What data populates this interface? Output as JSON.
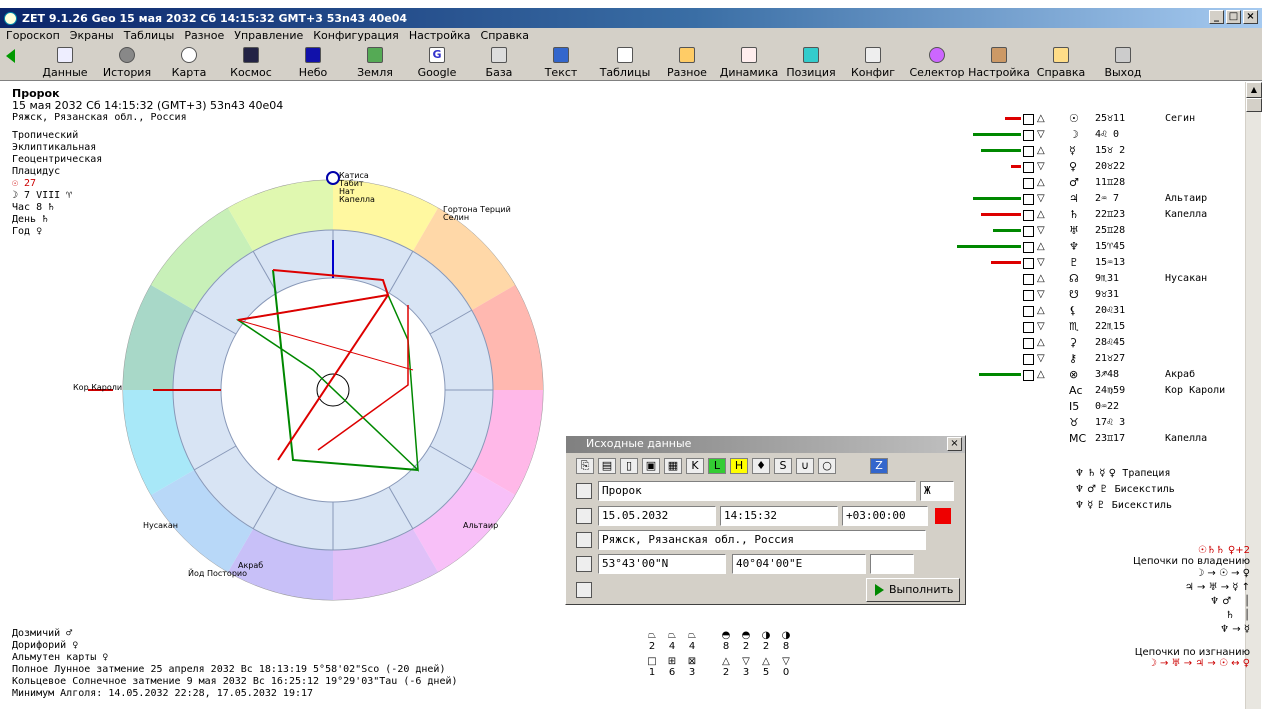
{
  "window": {
    "title": "ZET 9.1.26 Geo   15 мая 2032  Сб  14:15:32 GMT+3 53n43  40e04"
  },
  "menu": [
    "Гороскоп",
    "Экраны",
    "Таблицы",
    "Разное",
    "Управление",
    "Конфигурация",
    "Настройка",
    "Справка"
  ],
  "toolbar": [
    "Данные",
    "История",
    "Карта",
    "Космос",
    "Небо",
    "Земля",
    "Google",
    "База",
    "Текст",
    "Таблицы",
    "Разное",
    "Динамика",
    "Позиция",
    "Конфиг",
    "Селектор",
    "Настройка",
    "Справка",
    "Выход"
  ],
  "info": {
    "name": "Пророк",
    "date": "15 мая 2032  Сб  14:15:32 (GMT+3) 53n43  40e04",
    "place": "Ряжск, Рязанская обл., Россия",
    "zodiac": "Тропический",
    "coord": "Эклиптикальная",
    "center": "Геоцентрическая",
    "houses": "Плацидус",
    "sun_line": "☉  27",
    "moon_line": "☽  7 VIII ♈",
    "hour": "Час 8  ♄",
    "day": "День  ♄",
    "year": "Год  ♀"
  },
  "chart_labels": {
    "top": "Катиса",
    "top2": "Табит",
    "top3": "Нат",
    "top4": "Капелла",
    "right_top": "Гортона Терций",
    "right_top2": "Селин",
    "left": "Кор Кароли",
    "lower_left": "Нусакан",
    "lower_right": "Альтаир",
    "bottom": "Акраб",
    "bottom2": "Йод Посторио"
  },
  "planets": [
    {
      "glyph": "☉",
      "pos": "25♉11",
      "star": "Сегин"
    },
    {
      "glyph": "☽",
      "pos": " 4♌ 0",
      "star": ""
    },
    {
      "glyph": "☿",
      "pos": "15♉ 2",
      "star": ""
    },
    {
      "glyph": "♀",
      "pos": "20♉22",
      "star": ""
    },
    {
      "glyph": "♂",
      "pos": "11♊28",
      "star": ""
    },
    {
      "glyph": "♃",
      "pos": " 2♒ 7",
      "star": "Альтаир"
    },
    {
      "glyph": "♄",
      "pos": "22♊23",
      "star": "Капелла"
    },
    {
      "glyph": "♅",
      "pos": "25♊28",
      "star": ""
    },
    {
      "glyph": "♆",
      "pos": "15♈45",
      "star": ""
    },
    {
      "glyph": "♇",
      "pos": "15♒13",
      "star": ""
    },
    {
      "glyph": "☊",
      "pos": " 9♏31",
      "star": "Нусакан"
    },
    {
      "glyph": "☋",
      "pos": " 9♉31",
      "star": ""
    },
    {
      "glyph": "⚸",
      "pos": "20♌31",
      "star": ""
    },
    {
      "glyph": "♏",
      "pos": "22♏15",
      "star": ""
    },
    {
      "glyph": "⚳",
      "pos": "28♌45",
      "star": ""
    },
    {
      "glyph": "⚷",
      "pos": "21♉27",
      "star": ""
    },
    {
      "glyph": "⊗",
      "pos": " 3♐48",
      "star": "Акраб"
    },
    {
      "glyph": "Ас",
      "pos": "24♍59",
      "star": "Кор Кароли"
    },
    {
      "glyph": "I5",
      "pos": " 0♒22",
      "star": ""
    },
    {
      "glyph": "♉",
      "pos": "17♌ 3",
      "star": ""
    },
    {
      "glyph": "МС",
      "pos": "23♊17",
      "star": "Капелла"
    }
  ],
  "figures": [
    {
      "glyphs": "♆ ♄ ☿ ♀",
      "name": "Трапеция"
    },
    {
      "glyphs": "♆ ♂ ♇",
      "name": "Бисекстиль"
    },
    {
      "glyphs": "♆ ☿ ♇",
      "name": "Бисекстиль"
    }
  ],
  "bottom": {
    "l1": "Дозмичий  ♂",
    "l2": "Дорифорий  ♀",
    "l3": "Альмутен карты  ♀",
    "l4": "Полное Лунное затмение 25 апреля 2032 Вс 18:13:19  5°58'02\"Sco (-20 дней)",
    "l5": "Кольцевое Солнечное затмение 9 мая 2032 Вс 16:25:12 19°29'03\"Tau (-6 дней)",
    "l6": "Минимум Алголя: 14.05.2032 22:28, 17.05.2032 19:17"
  },
  "elements": {
    "row1": [
      "2",
      "4",
      "4",
      "8",
      "2",
      "2",
      "8"
    ],
    "row2": [
      "1",
      "6",
      "3",
      "2",
      "3",
      "5",
      "0"
    ]
  },
  "chains": {
    "title1": "Цепочки по владению",
    "title2": "Цепочки по изгнанию",
    "top": "☉♄♄ ♀+2"
  },
  "dialog": {
    "title": "Исходные данные",
    "name": "Пророк",
    "sex": "Ж",
    "date": "15.05.2032",
    "time": "14:15:32",
    "tz": "+03:00:00",
    "place": "Ряжск, Рязанская обл., Россия",
    "lat": "53°43'00\"N",
    "lon": "40°04'00\"E",
    "run": "Выполнить"
  },
  "colors": {
    "accent_red": "#e00000",
    "aspect_green": "#008000"
  }
}
